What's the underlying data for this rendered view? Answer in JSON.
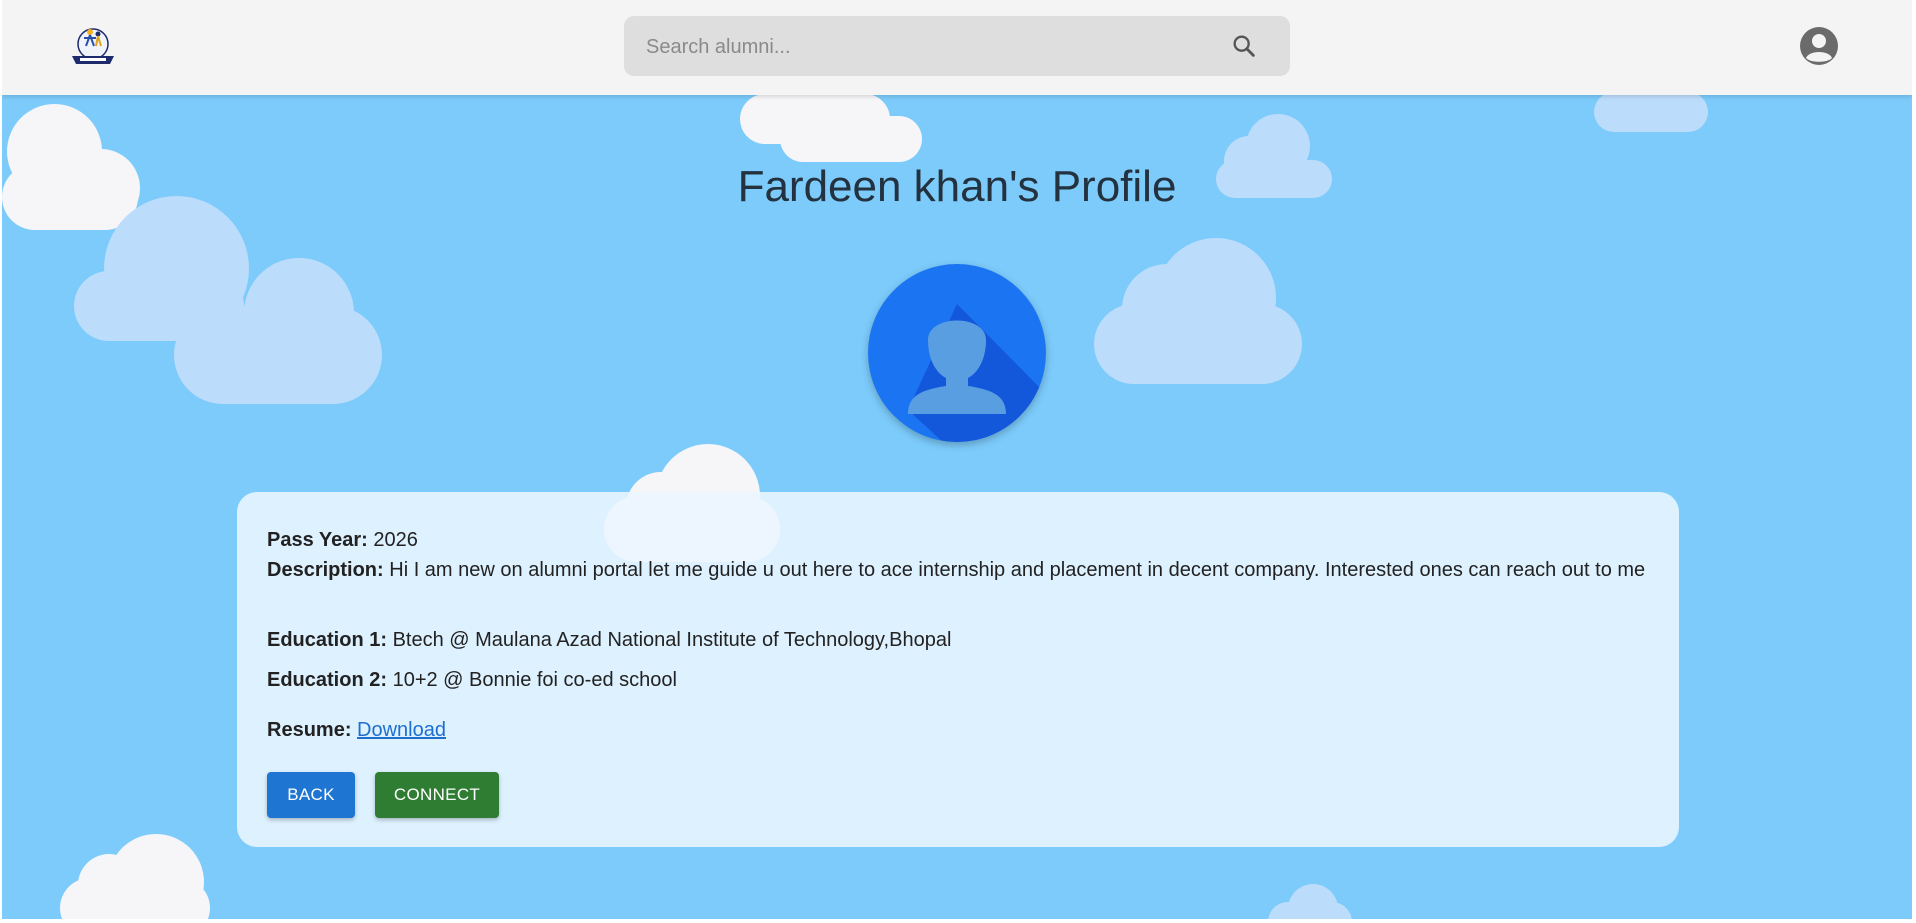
{
  "header": {
    "logo_icon": "alumni-logo-icon",
    "search": {
      "placeholder": "Search alumni...",
      "value": "",
      "icon": "search-icon"
    },
    "account_icon": "account-circle-icon"
  },
  "profile": {
    "title": "Fardeen khan's Profile",
    "avatar_icon": "user-silhouette-icon",
    "pass_year_label": "Pass Year:",
    "pass_year": "2026",
    "description_label": "Description:",
    "description": "Hi I am new on alumni portal let me guide u out here to ace internship and placement in decent company. Interested ones can reach out to me",
    "education1_label": "Education 1:",
    "education1": "Btech @ Maulana Azad National Institute of Technology,Bhopal",
    "education2_label": "Education 2:",
    "education2": "10+2 @ Bonnie foi co-ed school",
    "resume_label": "Resume:",
    "resume_link": "Download"
  },
  "actions": {
    "back_label": "BACK",
    "connect_label": "CONNECT"
  },
  "colors": {
    "background": "#7ccbfb",
    "header": "#f4f4f4",
    "back_button": "#1f76d2",
    "connect_button": "#2e7d32",
    "avatar": "#1b74f1"
  }
}
